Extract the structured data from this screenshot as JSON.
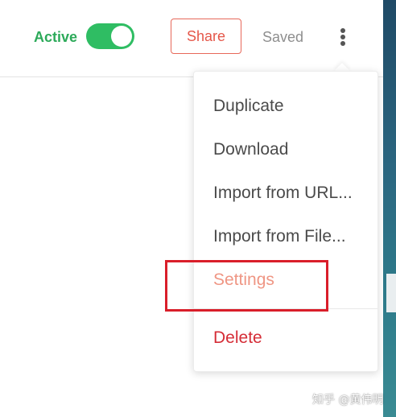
{
  "header": {
    "status_label": "Active",
    "toggle_on": true,
    "share_label": "Share",
    "saved_label": "Saved",
    "more_icon": "vertical-ellipsis-icon"
  },
  "menu": {
    "items": [
      {
        "label": "Duplicate"
      },
      {
        "label": "Download"
      },
      {
        "label": "Import from URL..."
      },
      {
        "label": "Import from File..."
      },
      {
        "label": "Settings"
      },
      {
        "label": "Delete"
      }
    ]
  },
  "watermark": "知乎 @黄伟明",
  "colors": {
    "active_green": "#2daa5a",
    "toggle_green": "#2fbd63",
    "share_red": "#e5574a",
    "settings_salmon": "#ef9684",
    "delete_red": "#d52d37",
    "highlight_red": "#d91e2a"
  }
}
